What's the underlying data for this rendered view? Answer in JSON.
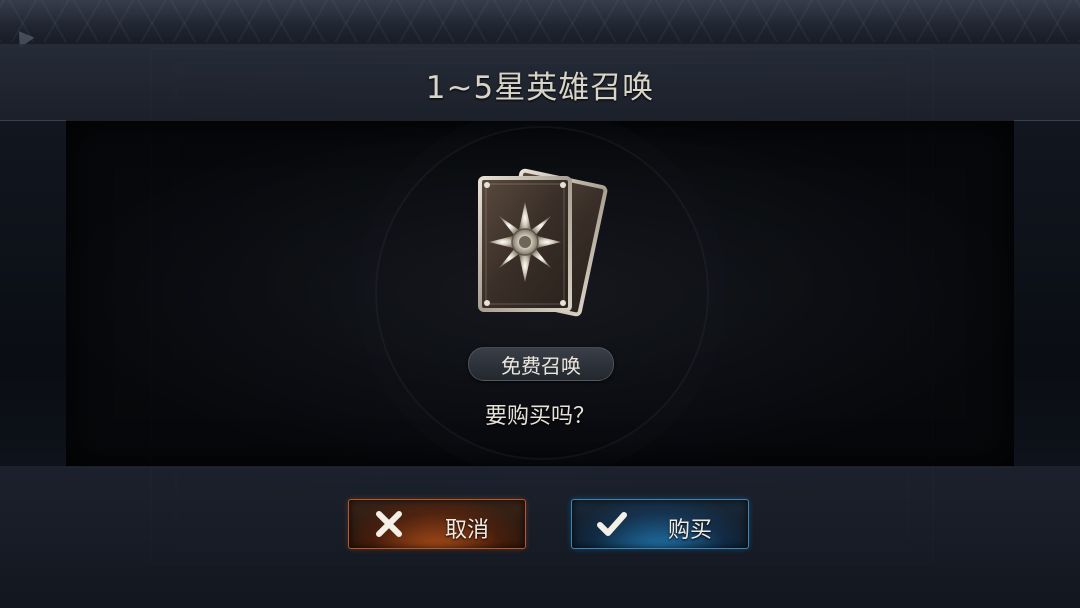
{
  "dialog": {
    "title": "1~5星英雄召唤",
    "free_label": "免费召唤",
    "question": "要购买吗？"
  },
  "buttons": {
    "cancel_label": "取消",
    "buy_label": "购买"
  },
  "icons": {
    "card": "summon-card-icon",
    "cancel": "close-icon",
    "buy": "check-icon"
  },
  "colors": {
    "cancel_accent": "#c9581f",
    "buy_accent": "#2f8fd0",
    "title_text": "#d9d4c8"
  }
}
